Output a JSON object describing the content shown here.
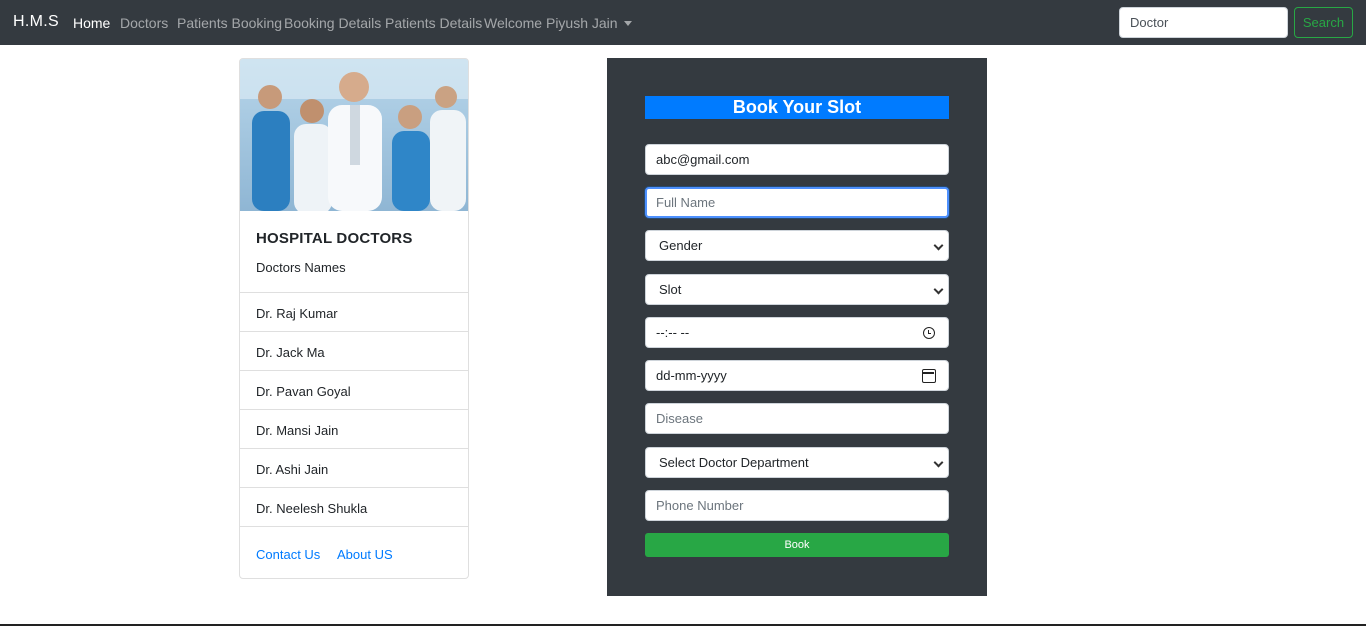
{
  "navbar": {
    "brand": "H.M.S",
    "links": [
      "Home",
      "Doctors",
      "Patients Booking",
      "Booking Details",
      "Patients Details",
      "Welcome Piyush Jain"
    ],
    "search_value": "Doctor",
    "search_button": "Search"
  },
  "card": {
    "title": "HOSPITAL DOCTORS",
    "subtitle": "Doctors Names",
    "doctors": [
      "Dr. Raj Kumar",
      "Dr. Jack Ma",
      "Dr. Pavan Goyal",
      "Dr. Mansi Jain",
      "Dr. Ashi Jain",
      "Dr. Neelesh Shukla"
    ],
    "links": [
      "Contact Us",
      "About US"
    ]
  },
  "form": {
    "title": "Book Your Slot",
    "email_value": "abc@gmail.com",
    "fullname_placeholder": "Full Name",
    "gender_select": "Gender",
    "slot_select": "Slot",
    "time_value": "--:-- --",
    "date_value": "dd-mm-yyyy",
    "disease_placeholder": "Disease",
    "department_select": "Select Doctor Department",
    "phone_placeholder": "Phone Number",
    "book_button": "Book"
  },
  "colors": {
    "navbar_bg": "#343a40",
    "primary": "#007bff",
    "success": "#28a745"
  }
}
